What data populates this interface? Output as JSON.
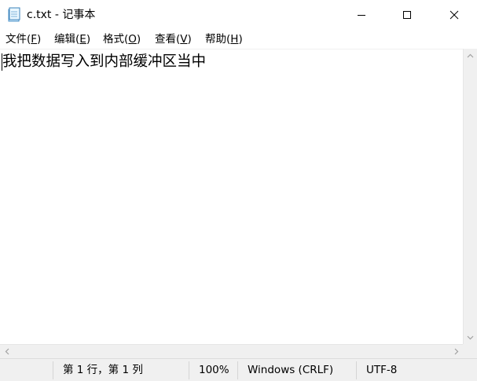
{
  "window": {
    "title": "c.txt - 记事本",
    "icon": "notepad-icon",
    "controls": {
      "minimize": "minimize-icon",
      "maximize": "maximize-icon",
      "close": "close-icon"
    }
  },
  "menu": {
    "items": [
      {
        "label_main": "文件(",
        "accel": "F",
        "label_end": ")"
      },
      {
        "label_main": "编辑(",
        "accel": "E",
        "label_end": ")"
      },
      {
        "label_main": "格式(",
        "accel": "O",
        "label_end": ")"
      },
      {
        "label_main": "查看(",
        "accel": "V",
        "label_end": ")"
      },
      {
        "label_main": "帮助(",
        "accel": "H",
        "label_end": ")"
      }
    ]
  },
  "editor": {
    "content": "我把数据写入到内部缓冲区当中"
  },
  "status": {
    "position": "第 1 行，第 1 列",
    "zoom": "100%",
    "line_ending": "Windows (CRLF)",
    "encoding": "UTF-8"
  },
  "colors": {
    "chrome": "#f0f0f0",
    "text": "#000000"
  }
}
